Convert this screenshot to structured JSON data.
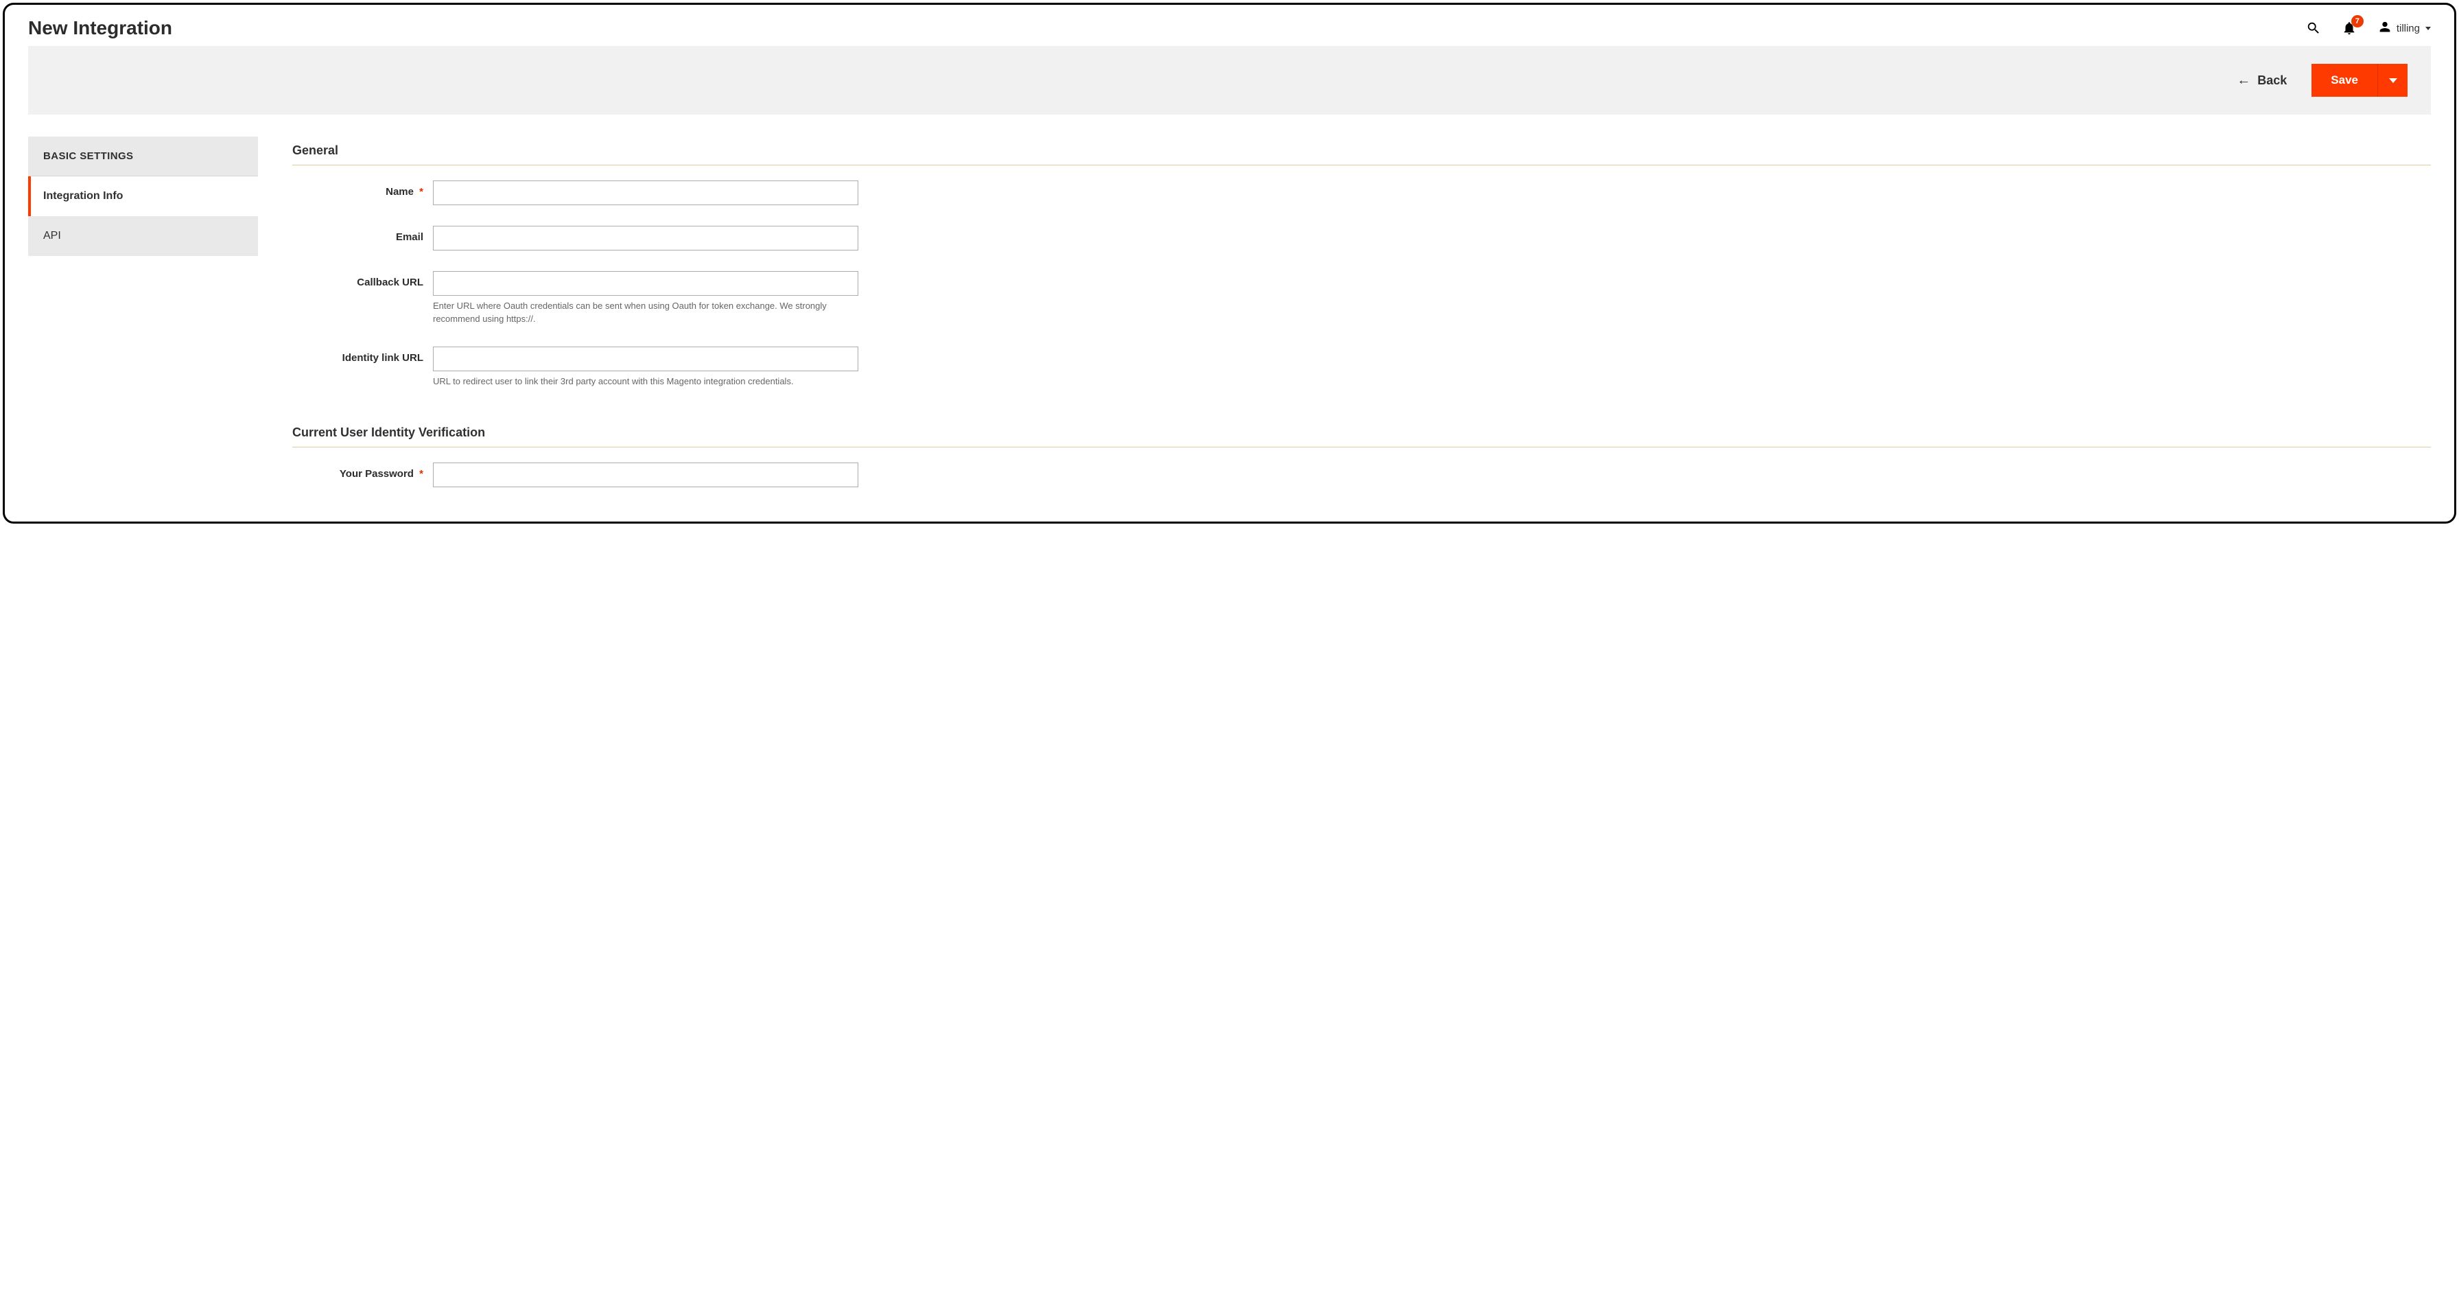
{
  "header": {
    "title": "New Integration",
    "username": "tilling",
    "notification_count": "7"
  },
  "actions": {
    "back_label": "Back",
    "save_label": "Save"
  },
  "sidebar": {
    "header": "BASIC SETTINGS",
    "items": [
      {
        "label": "Integration Info",
        "active": true
      },
      {
        "label": "API",
        "active": false
      }
    ]
  },
  "sections": {
    "general": {
      "title": "General",
      "fields": {
        "name": {
          "label": "Name",
          "required": true,
          "value": ""
        },
        "email": {
          "label": "Email",
          "required": false,
          "value": ""
        },
        "callback_url": {
          "label": "Callback URL",
          "required": false,
          "value": "",
          "help": "Enter URL where Oauth credentials can be sent when using Oauth for token exchange. We strongly recommend using https://."
        },
        "identity_link_url": {
          "label": "Identity link URL",
          "required": false,
          "value": "",
          "help": "URL to redirect user to link their 3rd party account with this Magento integration credentials."
        }
      }
    },
    "verification": {
      "title": "Current User Identity Verification",
      "fields": {
        "password": {
          "label": "Your Password",
          "required": true,
          "value": ""
        }
      }
    }
  },
  "required_marker": "*"
}
